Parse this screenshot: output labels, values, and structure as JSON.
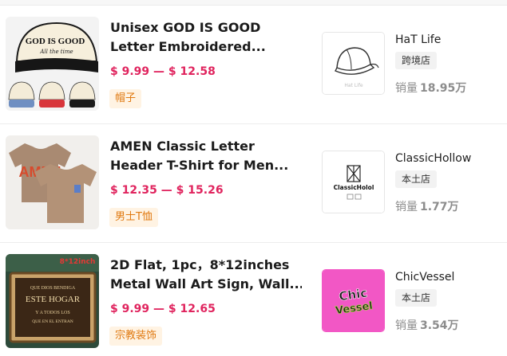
{
  "products": [
    {
      "title_line1": "Unisex GOD IS GOOD",
      "title_line2": "Letter Embroidered...",
      "price_min": "$ 9.99",
      "price_sep": "—",
      "price_max": "$ 12.58",
      "category_tag": "帽子",
      "image_icon": "baseball-cap-icon",
      "image_text": "GOD IS GOOD",
      "image_script": "All the time",
      "store": {
        "name": "HaT Life",
        "type": "跨境店",
        "logo_icon": "cap-outline-icon",
        "logo_text": "Hat Life"
      },
      "sales_label": "销量",
      "sales_value": "18.95万"
    },
    {
      "title_line1": "AMEN Classic Letter",
      "title_line2": "Header T-Shirt for Men...",
      "price_min": "$ 12.35",
      "price_sep": "—",
      "price_max": "$ 15.26",
      "category_tag": "男士T恤",
      "image_icon": "tshirt-icon",
      "image_text": "AMEN",
      "store": {
        "name": "ClassicHollow",
        "type": "本土店",
        "logo_icon": "tower-icon",
        "logo_text": "ClassicHolol"
      },
      "sales_label": "销量",
      "sales_value": "1.77万"
    },
    {
      "title_line1": "2D Flat, 1pc，8*12inches",
      "title_line2": "Metal Wall Art Sign, Wall...",
      "price_min": "$ 9.99",
      "price_sep": "—",
      "price_max": "$ 12.65",
      "category_tag": "宗教装饰",
      "image_icon": "wall-sign-icon",
      "image_size_label": "8*12inch",
      "image_sign_lines": [
        "QUE DIOS BENDIGA",
        "ESTE HOGAR",
        "Y A TODOS LOS",
        "QUE EN EL ENTRAN"
      ],
      "store": {
        "name": "ChicVessel",
        "type": "本土店",
        "logo_icon": "chic-vessel-logo-icon",
        "logo_text_line1": "Chic",
        "logo_text_line2": "Vessel"
      },
      "sales_label": "销量",
      "sales_value": "3.54万"
    }
  ],
  "colors": {
    "price": "#e0245e",
    "tag_text": "#e07a12",
    "tag_bg": "#fff3e3",
    "chic_logo_bg": "#f257c5"
  }
}
